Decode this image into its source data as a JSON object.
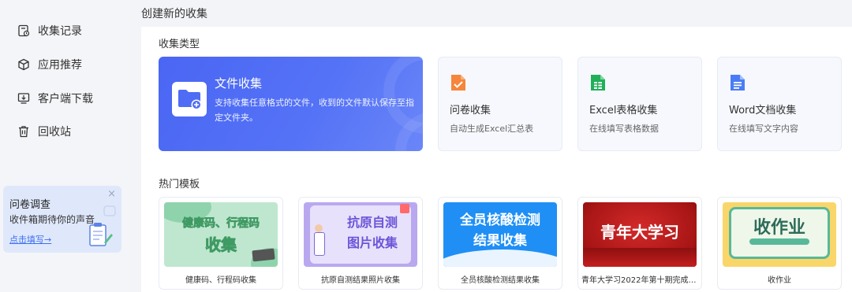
{
  "header": {
    "title": "创建新的收集"
  },
  "sidebar": {
    "items": [
      {
        "label": "收集记录",
        "icon": "history-icon"
      },
      {
        "label": "应用推荐",
        "icon": "cube-icon"
      },
      {
        "label": "客户端下载",
        "icon": "download-icon"
      },
      {
        "label": "回收站",
        "icon": "trash-icon"
      }
    ],
    "survey": {
      "title": "问卷调查",
      "subtitle": "收件箱期待你的声音",
      "link": "点击填写→",
      "close": "×"
    }
  },
  "main": {
    "types_title": "收集类型",
    "types": [
      {
        "title": "文件收集",
        "desc": "支持收集任意格式的文件，收到的文件默认保存至指定文件夹。",
        "icon": "folder-plus-icon"
      },
      {
        "title": "问卷收集",
        "desc": "自动生成Excel汇总表",
        "icon": "questionnaire-icon",
        "color": "#f5863b"
      },
      {
        "title": "Excel表格收集",
        "desc": "在线填写表格数据",
        "icon": "sheet-icon",
        "color": "#21b05a"
      },
      {
        "title": "Word文档收集",
        "desc": "在线填写文字内容",
        "icon": "doc-icon",
        "color": "#4a7df5"
      }
    ],
    "templates_title": "热门模板",
    "templates": [
      {
        "caption": "健康码、行程码收集",
        "thumb_lines": [
          "健康码、行程码",
          "收集"
        ]
      },
      {
        "caption": "抗原自测结果照片收集",
        "thumb_lines": [
          "抗原自测",
          "图片收集"
        ]
      },
      {
        "caption": "全员核酸检测结果收集",
        "thumb_lines": [
          "全员核酸检测",
          "结果收集"
        ]
      },
      {
        "caption": "青年大学习2022年第十期完成统...",
        "thumb_lines": [
          "青年大学习"
        ]
      },
      {
        "caption": "收作业",
        "thumb_lines": [
          "收作业"
        ]
      }
    ]
  }
}
